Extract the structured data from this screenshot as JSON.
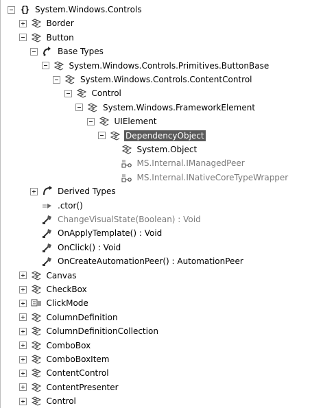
{
  "tree": {
    "rows": [
      {
        "label": "System.Windows.Controls",
        "icon": "namespace-icon",
        "toggle": "minus",
        "indent": 0
      },
      {
        "label": "Border",
        "icon": "class-icon",
        "toggle": "plus",
        "indent": 1
      },
      {
        "label": "Button",
        "icon": "class-icon",
        "toggle": "minus",
        "indent": 1
      },
      {
        "label": "Base Types",
        "icon": "base-types-icon",
        "toggle": "minus",
        "indent": 2
      },
      {
        "label": "System.Windows.Controls.Primitives.ButtonBase",
        "icon": "class-icon",
        "toggle": "minus",
        "indent": 3
      },
      {
        "label": "System.Windows.Controls.ContentControl",
        "icon": "class-icon",
        "toggle": "minus",
        "indent": 4
      },
      {
        "label": "Control",
        "icon": "class-icon",
        "toggle": "minus",
        "indent": 5
      },
      {
        "label": "System.Windows.FrameworkElement",
        "icon": "class-icon",
        "toggle": "minus",
        "indent": 6
      },
      {
        "label": "UIElement",
        "icon": "class-icon",
        "toggle": "minus",
        "indent": 7
      },
      {
        "label": "DependencyObject",
        "icon": "class-icon",
        "toggle": "minus",
        "indent": 8,
        "selected": true
      },
      {
        "label": "System.Object",
        "icon": "class-icon",
        "toggle": "none",
        "indent": 9
      },
      {
        "label": "MS.Internal.IManagedPeer",
        "icon": "interface-icon",
        "toggle": "none",
        "indent": 9,
        "gray": true
      },
      {
        "label": "MS.Internal.INativeCoreTypeWrapper",
        "icon": "interface-icon",
        "toggle": "none",
        "indent": 9,
        "gray": true
      },
      {
        "label": "Derived Types",
        "icon": "derived-types-icon",
        "toggle": "plus",
        "indent": 2
      },
      {
        "label": ".ctor()",
        "icon": "constructor-icon",
        "toggle": "none",
        "indent": 2
      },
      {
        "label": "ChangeVisualState(Boolean) : Void",
        "icon": "method-icon",
        "toggle": "none",
        "indent": 2,
        "gray": true
      },
      {
        "label": "OnApplyTemplate() : Void",
        "icon": "method-icon",
        "toggle": "none",
        "indent": 2
      },
      {
        "label": "OnClick() : Void",
        "icon": "method-icon",
        "toggle": "none",
        "indent": 2
      },
      {
        "label": "OnCreateAutomationPeer() : AutomationPeer",
        "icon": "method-icon",
        "toggle": "none",
        "indent": 2
      },
      {
        "label": "Canvas",
        "icon": "class-icon",
        "toggle": "plus",
        "indent": 1
      },
      {
        "label": "CheckBox",
        "icon": "class-icon",
        "toggle": "plus",
        "indent": 1
      },
      {
        "label": "ClickMode",
        "icon": "enum-icon",
        "toggle": "plus",
        "indent": 1
      },
      {
        "label": "ColumnDefinition",
        "icon": "class-icon",
        "toggle": "plus",
        "indent": 1
      },
      {
        "label": "ColumnDefinitionCollection",
        "icon": "class-icon",
        "toggle": "plus",
        "indent": 1
      },
      {
        "label": "ComboBox",
        "icon": "class-icon",
        "toggle": "plus",
        "indent": 1
      },
      {
        "label": "ComboBoxItem",
        "icon": "class-icon",
        "toggle": "plus",
        "indent": 1
      },
      {
        "label": "ContentControl",
        "icon": "class-icon",
        "toggle": "plus",
        "indent": 1
      },
      {
        "label": "ContentPresenter",
        "icon": "class-icon",
        "toggle": "plus",
        "indent": 1
      },
      {
        "label": "Control",
        "icon": "class-icon",
        "toggle": "plus",
        "indent": 1
      }
    ]
  },
  "colors": {
    "selection_bg": "#5a5a5a",
    "gray_text": "#7a7a7a",
    "icon_dark": "#3a3a3a"
  }
}
